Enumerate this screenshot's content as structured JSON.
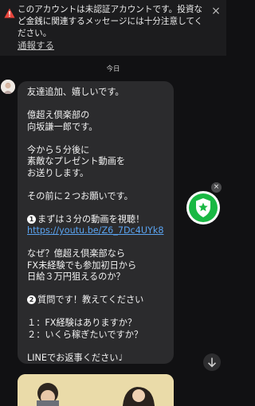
{
  "banner": {
    "warning_text": "このアカウントは未認証アカウントです。投資など金銭に関連するメッセージには十分注意してください。",
    "report_link": "通報する",
    "close_symbol": "×"
  },
  "date_label": "今日",
  "message": {
    "lines": [
      "友達追加、嬉しいです。",
      "",
      "億超え倶楽部の",
      "向坂謙一郎です。",
      "",
      "今から５分後に",
      "素敵なプレゼント動画を",
      "お送りします。",
      "",
      "その前に２つお願いです。",
      "",
      "まずは３分の動画を視聴！",
      "https://youtu.be/Z6_7Dc4UYk8",
      "",
      "なぜ？億超え倶楽部なら",
      "FX未経験でも参加初日から",
      "日給３万円狙えるのか？",
      "",
      "質問です！教えてください",
      "",
      "１：FX経験はありますか？",
      "２：いくら稼ぎたいですか？",
      "",
      "LINEでお返事ください♩"
    ],
    "num1": "1",
    "num2": "2"
  },
  "badge_close_symbol": "×",
  "colors": {
    "background": "#111113",
    "bubble": "#2b2b2d",
    "link": "#5aa3f0",
    "badge_green": "#19b843",
    "warning_red": "#e8453c"
  }
}
